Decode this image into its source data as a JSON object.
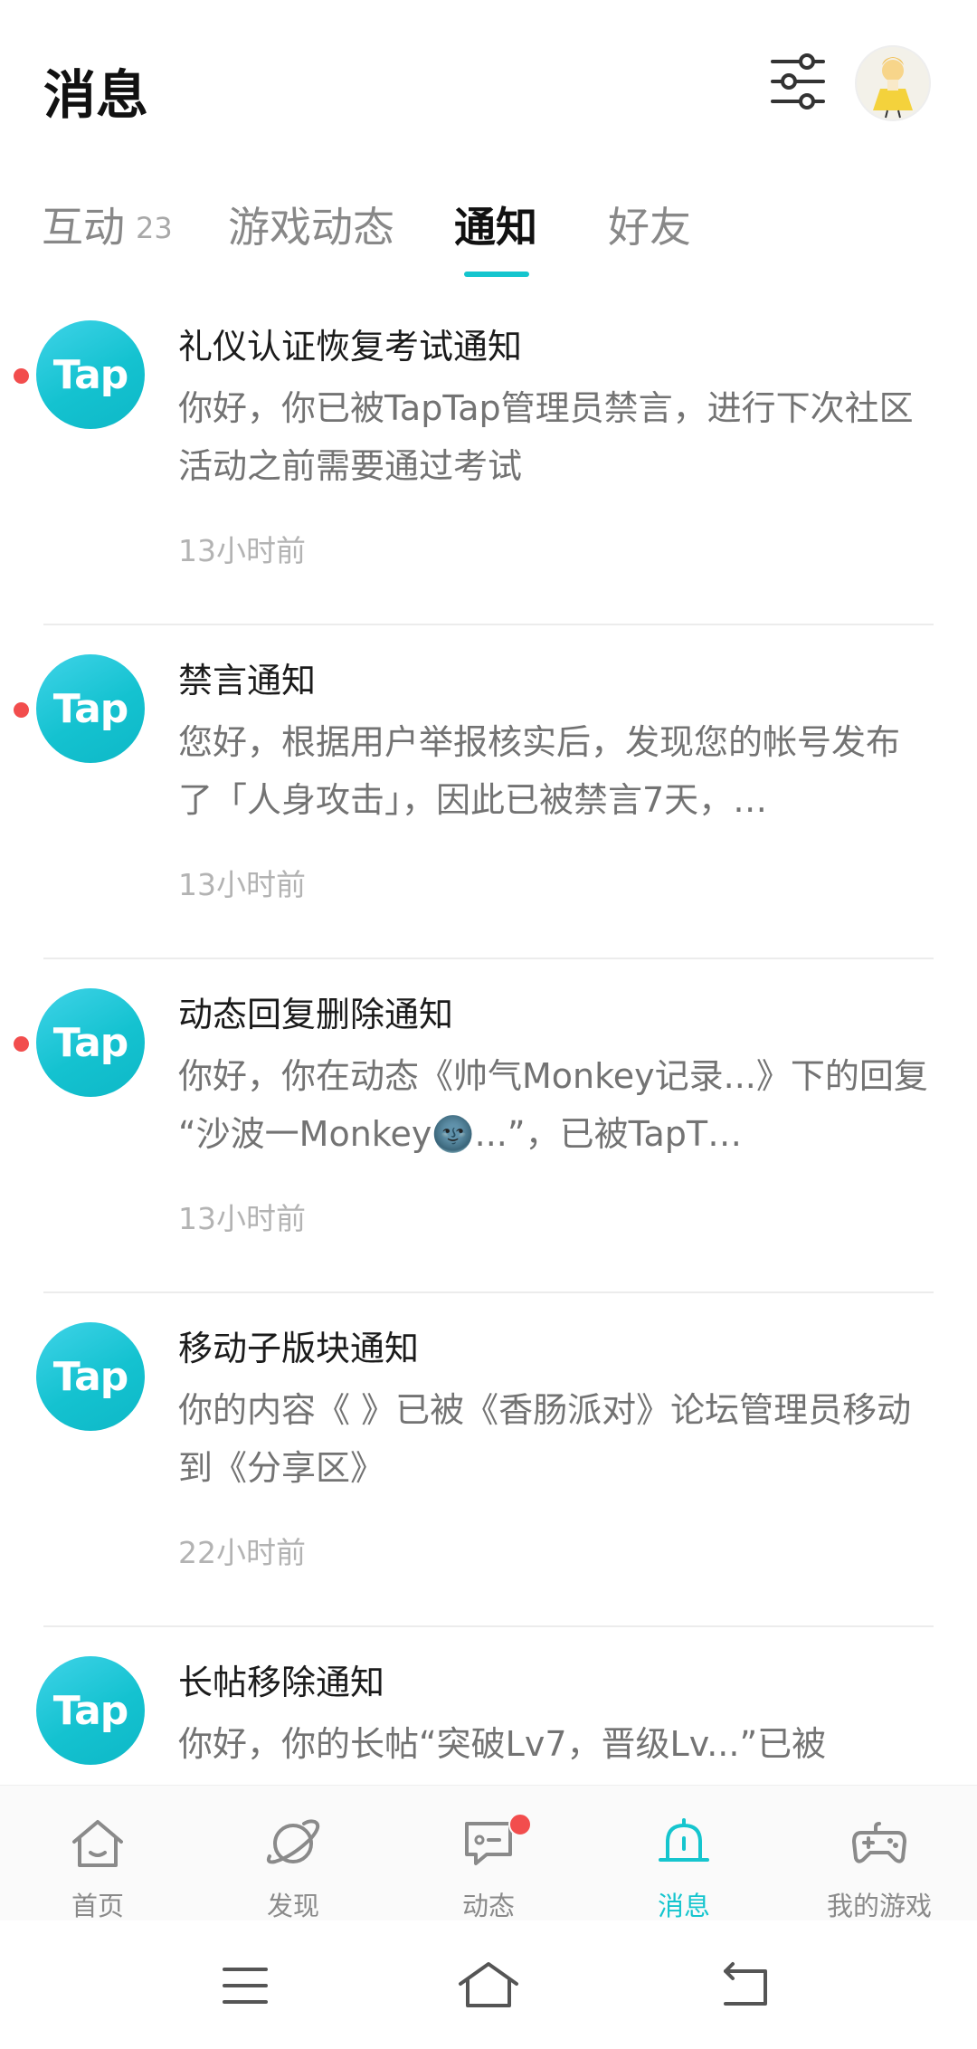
{
  "header": {
    "title": "消息"
  },
  "tabs": [
    {
      "label": "互动",
      "count": "23"
    },
    {
      "label": "游戏动态"
    },
    {
      "label": "通知"
    },
    {
      "label": "好友"
    }
  ],
  "notifications": [
    {
      "logo": "Tap",
      "title": "礼仪认证恢复考试通知",
      "body": "你好，你已被TapTap管理员禁言，进行下次社区活动之前需要通过考试",
      "time": "13小时前",
      "unread": true
    },
    {
      "logo": "Tap",
      "title": "禁言通知",
      "body": "您好，根据用户举报核实后，发现您的帐号发布了「人身攻击」，因此已被禁言7天，…",
      "time": "13小时前",
      "unread": true
    },
    {
      "logo": "Tap",
      "title": "动态回复删除通知",
      "body": "你好，你在动态《帅气Monkey记录...》下的回复 “沙波一Monkey🌚...”，已被TapT…",
      "time": "13小时前",
      "unread": true
    },
    {
      "logo": "Tap",
      "title": "移动子版块通知",
      "body": "你的内容《 》已被《香肠派对》论坛管理员移动到《分享区》",
      "time": "22小时前",
      "unread": false
    },
    {
      "logo": "Tap",
      "title": "长帖移除通知",
      "body": "你好，你的长帖“突破Lv7，晋级Lv...”已被",
      "time": "",
      "unread": false
    }
  ],
  "bottom_nav": [
    {
      "label": "首页",
      "icon": "home-icon"
    },
    {
      "label": "发现",
      "icon": "planet-icon"
    },
    {
      "label": "动态",
      "icon": "chat-icon",
      "badge": true
    },
    {
      "label": "消息",
      "icon": "bell-icon",
      "active": true
    },
    {
      "label": "我的游戏",
      "icon": "gamepad-icon"
    }
  ],
  "colors": {
    "accent": "#15c5ce",
    "badge": "#f24d4d"
  }
}
